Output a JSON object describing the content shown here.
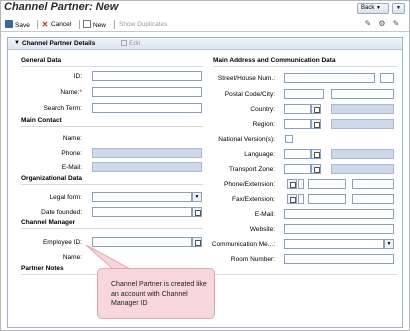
{
  "title": "Channel Partner: New",
  "nav": {
    "back_label": "Back",
    "back_arrow": "▼",
    "history_arrow": "▼"
  },
  "toolbar": {
    "save": "Save",
    "cancel": "Cancel",
    "new": "New",
    "show_duplicates": "Show Duplicates"
  },
  "panel": {
    "title": "Channel Partner Details",
    "edit_label": "Edit"
  },
  "left": {
    "general_data": {
      "heading": "General Data",
      "id_label": "ID:",
      "name_label": "Name:",
      "name_required": "*",
      "search_term_label": "Search Term:"
    },
    "main_contact": {
      "heading": "Main Contact",
      "name_label": "Name:",
      "phone_label": "Phone:",
      "email_label": "E-Mail:"
    },
    "organizational_data": {
      "heading": "Organizational Data",
      "legal_form_label": "Legal form:",
      "date_founded_label": "Date founded:"
    },
    "channel_manager": {
      "heading": "Channel Manager",
      "employee_id_label": "Employee ID:",
      "name_label": "Name:"
    },
    "partner_notes": {
      "heading": "Partner Notes"
    }
  },
  "right": {
    "heading": "Main Address and Communication Data",
    "street_label": "Street/House Num.:",
    "postal_label": "Postal Code/City:",
    "country_label": "Country:",
    "region_label": "Region:",
    "national_versions_label": "National Version(s):",
    "language_label": "Language:",
    "transport_zone_label": "Transport Zone:",
    "phone_ext_label": "Phone/Extension:",
    "fax_ext_label": "Fax/Extension:",
    "email_label": "E-Mail:",
    "website_label": "Website:",
    "comm_method_label": "Communication Me...:",
    "room_number_label": "Room Number:"
  },
  "callout": {
    "text": "Channel Partner is created like an account with Channel Manager ID"
  },
  "colors": {
    "readonly_field": "#cdd9ea",
    "callout_fill": "#f8d7dc",
    "panel_border": "#9fb3cc"
  }
}
